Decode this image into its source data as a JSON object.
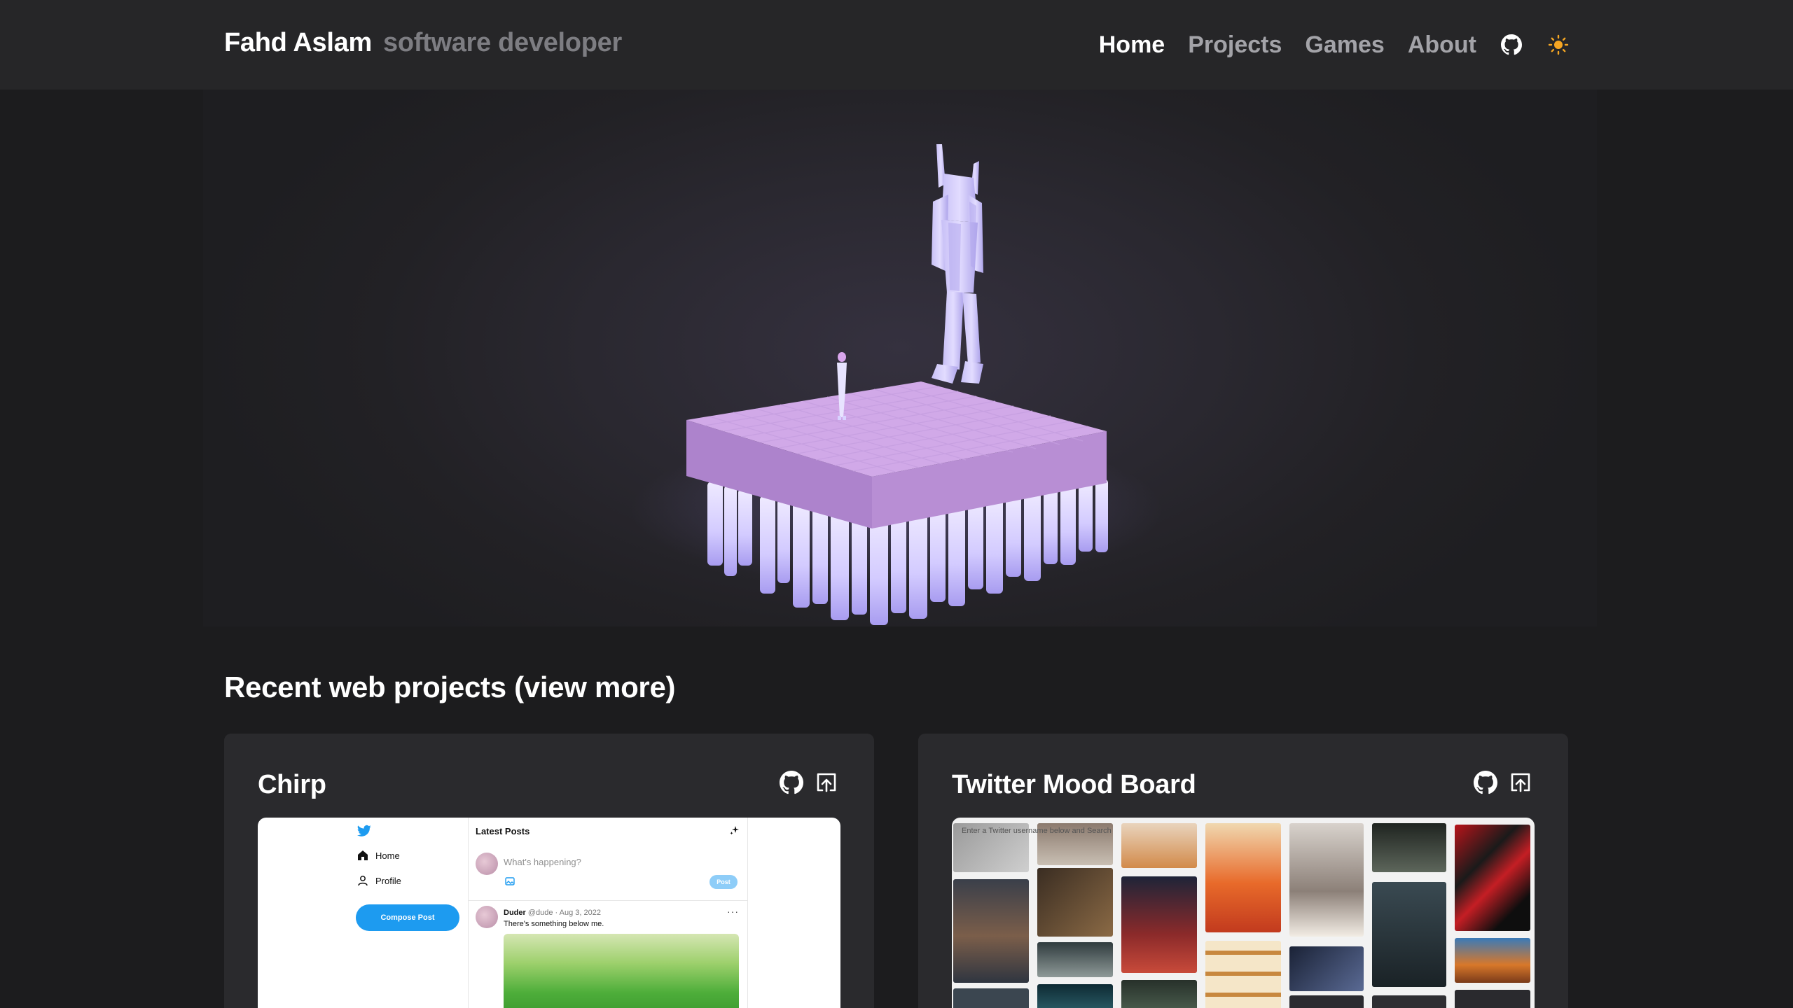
{
  "header": {
    "name": "Fahd Aslam",
    "role": "software developer",
    "nav": [
      {
        "label": "Home",
        "active": true
      },
      {
        "label": "Projects",
        "active": false
      },
      {
        "label": "Games",
        "active": false
      },
      {
        "label": "About",
        "active": false
      }
    ],
    "icons": [
      "github-icon",
      "sun-icon"
    ]
  },
  "hero": {
    "scene": "low-poly robot figure and small character on purple floating platform"
  },
  "section": {
    "title": "Recent web projects (view more)"
  },
  "projects": [
    {
      "title": "Chirp",
      "actions": [
        "github-icon",
        "open-external-icon"
      ],
      "preview": {
        "nav": [
          "Home",
          "Profile"
        ],
        "compose_button": "Compose Post",
        "feed_title": "Latest Posts",
        "placeholder": "What's happening?",
        "post_button": "Post",
        "post_author": "Duder",
        "post_handle": "@dude · Aug 3, 2022",
        "post_text": "There's something below me."
      }
    },
    {
      "title": "Twitter Mood Board",
      "actions": [
        "github-icon",
        "open-external-icon"
      ],
      "preview": {
        "search_hint": "Enter a Twitter username below and Search"
      }
    }
  ],
  "colors": {
    "background": "#1c1c1e",
    "header": "#262628",
    "card": "#2a2a2d",
    "accent_sun": "#f5a623",
    "platform": "#b187d4",
    "glow": "#d6d0ff"
  }
}
